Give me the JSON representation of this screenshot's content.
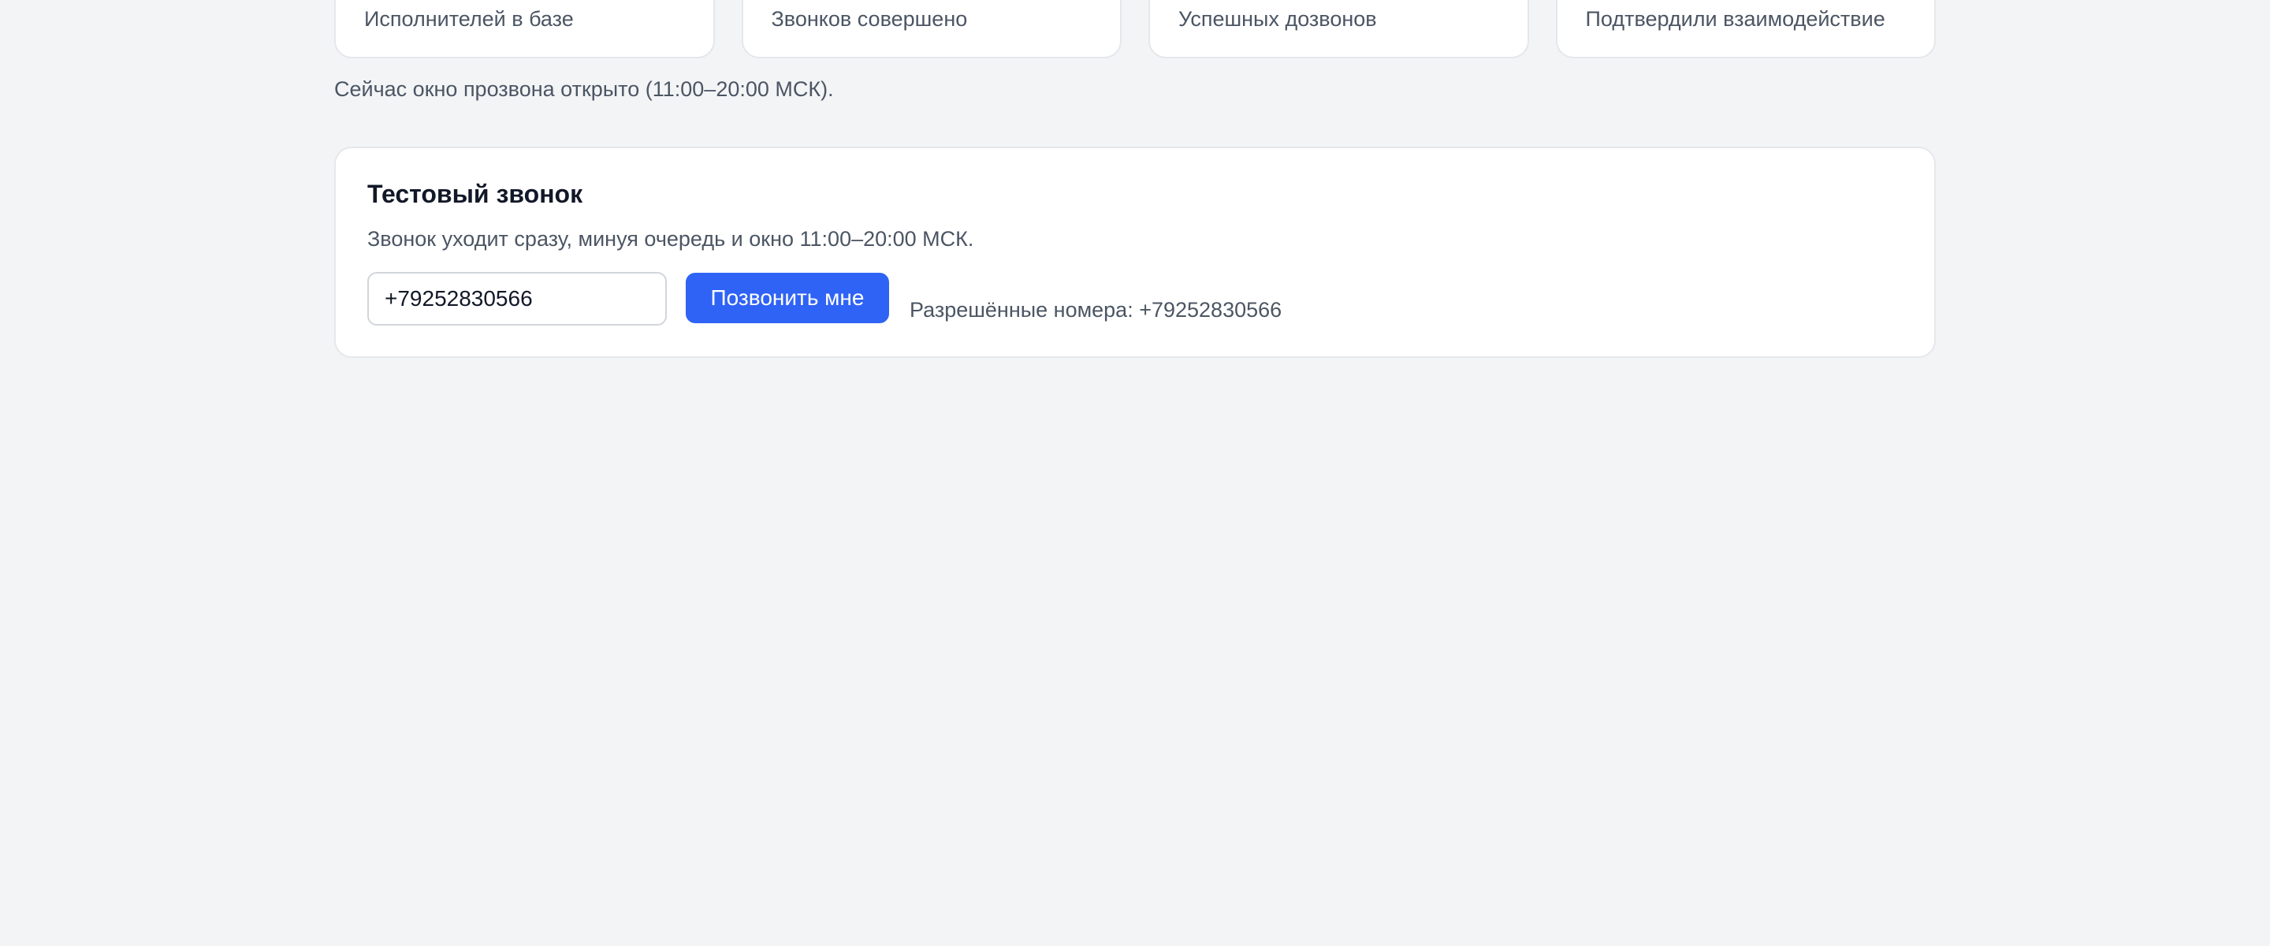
{
  "stats": [
    {
      "label": "Исполнителей в базе"
    },
    {
      "label": "Звонков совершено"
    },
    {
      "label": "Успешных дозвонов"
    },
    {
      "label": "Подтвердили взаимодействие"
    }
  ],
  "window_note": "Сейчас окно прозвона открыто (11:00–20:00 МСК).",
  "test_call": {
    "title": "Тестовый звонок",
    "description": "Звонок уходит сразу, минуя очередь и окно 11:00–20:00 МСК.",
    "phone_value": "+79252830566",
    "button_label": "Позвонить мне",
    "allowed_numbers": "Разрешённые номера: +79252830566"
  },
  "colors": {
    "accent": "#2f63f5",
    "background": "#f3f4f6",
    "card": "#ffffff",
    "muted_text": "#4b5563"
  }
}
